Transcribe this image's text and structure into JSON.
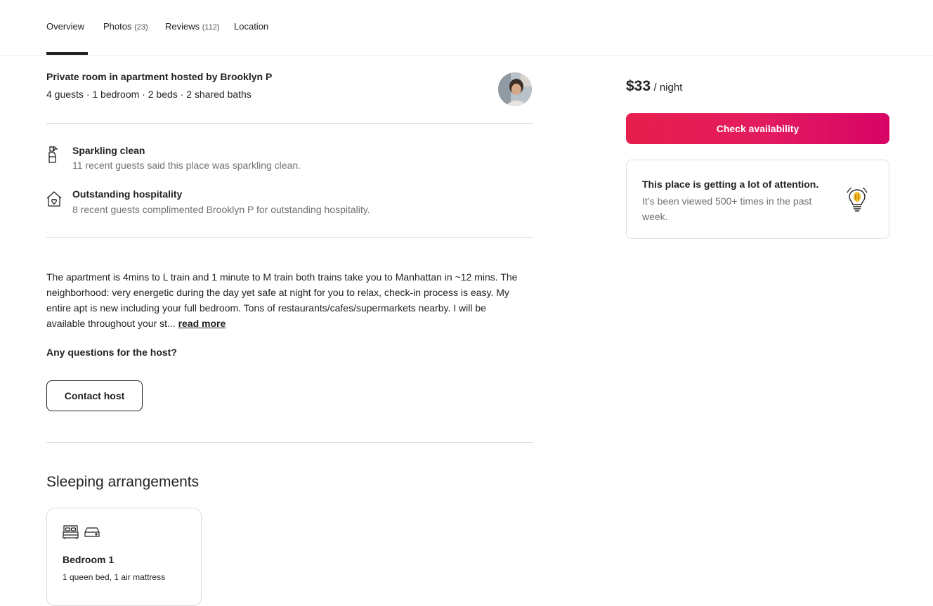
{
  "nav": {
    "tabs": [
      {
        "label": "Overview",
        "count": ""
      },
      {
        "label": "Photos",
        "count": "(23)"
      },
      {
        "label": "Reviews",
        "count": "(112)"
      },
      {
        "label": "Location",
        "count": ""
      }
    ],
    "active_tab": "Overview"
  },
  "listing": {
    "title": "Private room in apartment hosted by Brooklyn P",
    "details": "4 guests · 1 bedroom · 2 beds · 2 shared baths"
  },
  "highlights": [
    {
      "title": "Sparkling clean",
      "subtitle": "11 recent guests said this place was sparkling clean.",
      "icon": "spray-bottle-icon"
    },
    {
      "title": "Outstanding hospitality",
      "subtitle": "8 recent guests complimented Brooklyn P for outstanding hospitality.",
      "icon": "house-heart-icon"
    }
  ],
  "description": {
    "text": "The apartment is 4mins to L train and 1 minute to M train both trains take you to Manhattan in ~12 mins. The neighborhood: very energetic during the day yet safe at night for you to relax, check-in process is easy. My entire apt is new including your full bedroom. Tons of restaurants/cafes/supermarkets nearby. I will be available throughout your st...",
    "read_more": "read more"
  },
  "contact": {
    "question": "Any questions for the host?",
    "button_label": "Contact host"
  },
  "sleeping": {
    "title": "Sleeping arrangements",
    "rooms": [
      {
        "name": "Bedroom 1",
        "beds": "1 queen bed, 1 air mattress",
        "icons": [
          "queen-bed-icon",
          "air-mattress-icon"
        ]
      }
    ]
  },
  "booking": {
    "price": "$33",
    "per": "/ night",
    "button_label": "Check availability",
    "accent_color": "#e61e4d"
  },
  "attention": {
    "title": "This place is getting a lot of attention.",
    "subtitle": "It’s been viewed 500+ times in the past week.",
    "icon": "lightbulb-icon"
  }
}
